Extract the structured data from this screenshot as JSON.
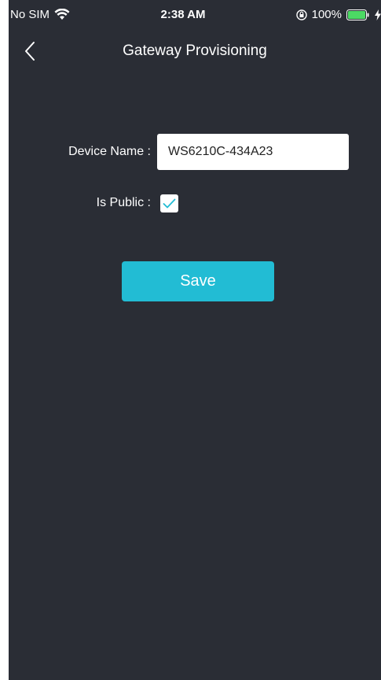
{
  "status_bar": {
    "carrier": "No SIM",
    "time": "2:38 AM",
    "battery": "100%"
  },
  "nav": {
    "title": "Gateway Provisioning",
    "back_icon": "chevron-left-icon"
  },
  "form": {
    "device_name_label": "Device Name :",
    "device_name_value": "WS6210C-434A23",
    "is_public_label": "Is Public :",
    "is_public_checked": true,
    "save_label": "Save"
  },
  "colors": {
    "background": "#2a2d35",
    "accent": "#22bcd4",
    "checkmark": "#22bcd4"
  }
}
